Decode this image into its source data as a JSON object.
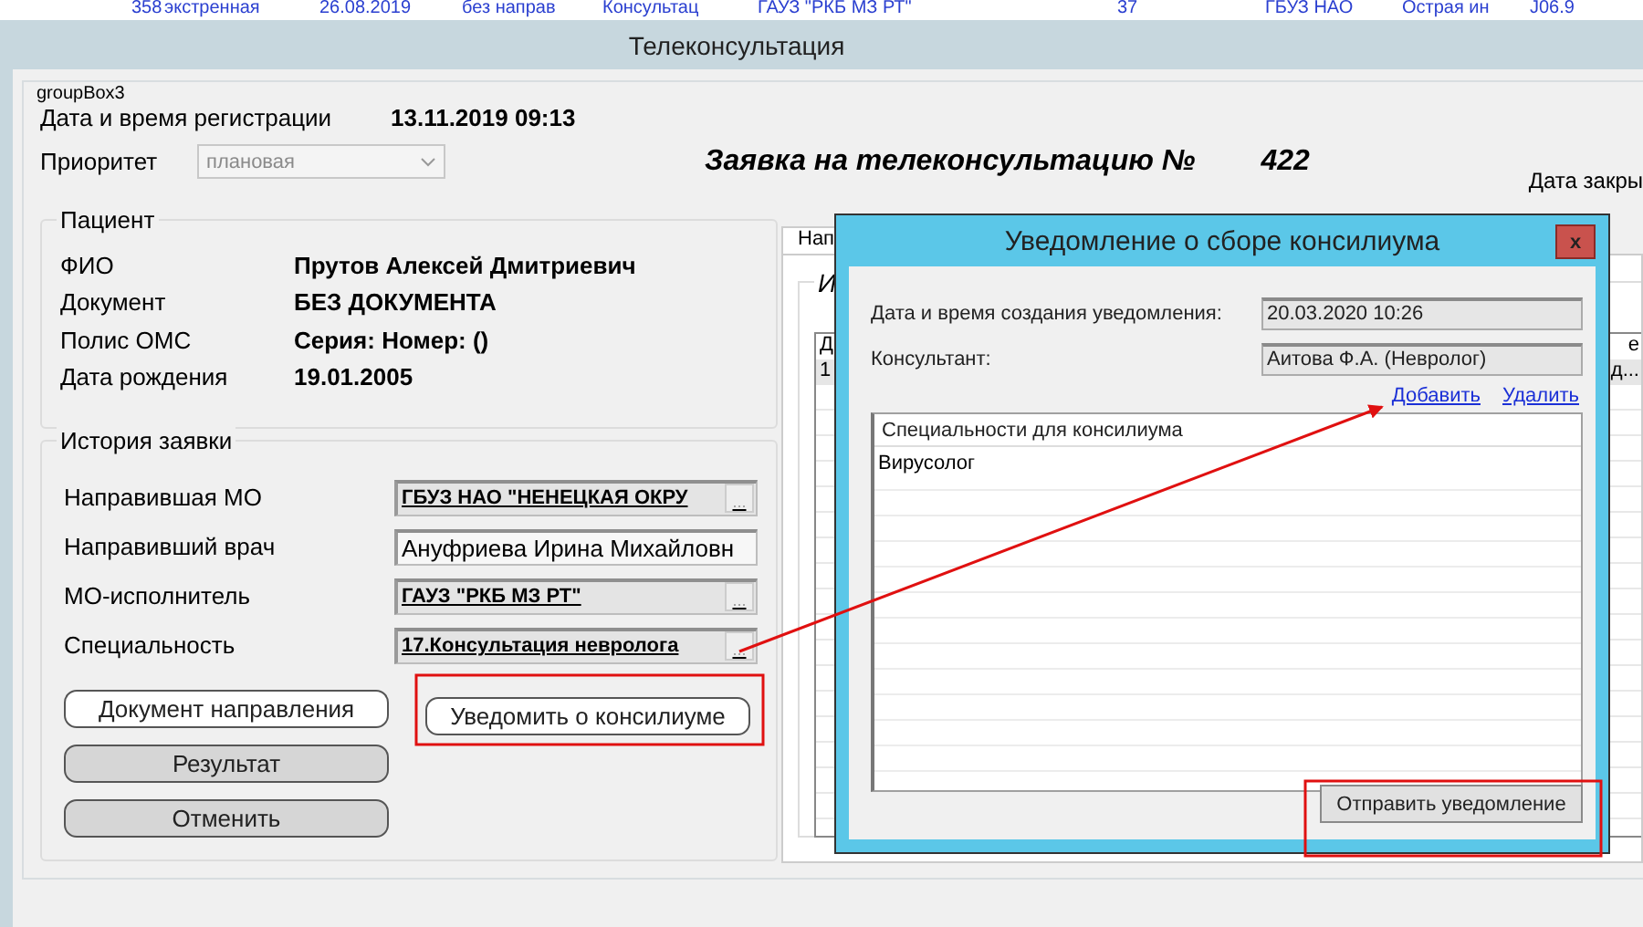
{
  "background_row": [
    "358",
    "экстренная",
    "26.08.2019",
    "без направ",
    "Консультац",
    "ГАУЗ \"РКБ МЗ РТ\"",
    "37",
    "ГБУЗ НАО",
    "Острая ин",
    "J06.9"
  ],
  "window": {
    "title": "Телеконсультация"
  },
  "group_title": "groupBox3",
  "registration": {
    "label": "Дата и время регистрации",
    "value": "13.11.2019 09:13"
  },
  "priority": {
    "label": "Приоритет",
    "value": "плановая",
    "disabled": true
  },
  "heading": {
    "text": "Заявка на телеконсультацию №",
    "number": "422"
  },
  "close_date_label": "Дата закры",
  "patient": {
    "title": "Пациент",
    "fields": [
      {
        "label": "ФИО",
        "value": "Прутов Алексей Дмитриевич"
      },
      {
        "label": "Документ",
        "value": "БЕЗ ДОКУМЕНТА"
      },
      {
        "label": "Полис ОМС",
        "value": "Серия:  Номер:  ()"
      },
      {
        "label": "Дата рождения",
        "value": "19.01.2005"
      }
    ]
  },
  "history": {
    "title": "История заявки",
    "fields": [
      {
        "label": "Направившая МО",
        "value": "ГБУЗ НАО \"НЕНЕЦКАЯ ОКРУ",
        "kind": "lookup",
        "browse": "..."
      },
      {
        "label": "Направивший врач",
        "value": "Ануфриева Ирина Михайловн",
        "kind": "text"
      },
      {
        "label": "МО-исполнитель",
        "value": "ГАУЗ \"РКБ МЗ РТ\"",
        "kind": "lookup",
        "browse": "..."
      },
      {
        "label": "Специальность",
        "value": "17.Консультация невролога",
        "kind": "lookup",
        "browse": "..."
      }
    ],
    "buttons": [
      {
        "label": "Документ направления",
        "kind": "light"
      },
      {
        "label": "Результат",
        "kind": "grey"
      },
      {
        "label": "Отменить",
        "kind": "grey"
      }
    ],
    "notify_button": "Уведомить о консилиуме"
  },
  "back_tab": {
    "tab": "Нап",
    "group": "И",
    "grid_header": [
      "Д",
      "е"
    ],
    "grid_row": [
      "1",
      "д..."
    ]
  },
  "dialog": {
    "title": "Уведомление о сборе консилиума",
    "close": "x",
    "fields": [
      {
        "label": "Дата и время создания уведомления:",
        "value": "20.03.2020 10:26"
      },
      {
        "label": "Консультант:",
        "value": "Аитова Ф.А. (Невролог)"
      }
    ],
    "links": [
      "Добавить",
      "Удалить"
    ],
    "list": {
      "header": "Специальности для консилиума",
      "rows": [
        "Вирусолог"
      ]
    },
    "send_button": "Отправить уведомление"
  }
}
